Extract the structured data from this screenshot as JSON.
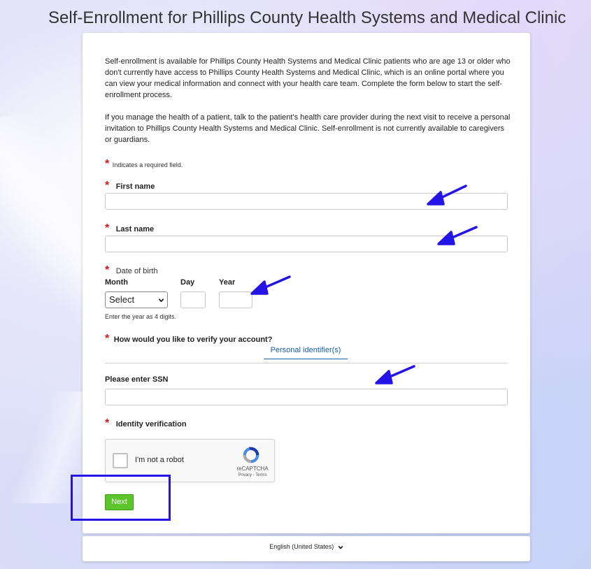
{
  "page": {
    "title": "Self-Enrollment for Phillips County Health Systems and Medical Clinic"
  },
  "intro": {
    "paragraph1": "Self-enrollment is available for Phillips County Health Systems and Medical Clinic patients who are age 13 or older who don't currently have access to Phillips County Health Systems and Medical Clinic, which is an online portal where you can view your medical information and connect with your health care team. Complete the form below to start the self-enrollment process.",
    "paragraph2": "If you manage the health of a patient, talk to the patient's health care provider during the next visit to receive a personal invitation to Phillips County Health Systems and Medical Clinic. Self-enrollment is not currently available to caregivers or guardians."
  },
  "required_marker": "*",
  "required_note": "Indicates a required field.",
  "form": {
    "first_name": {
      "label": "First name",
      "value": ""
    },
    "last_name": {
      "label": "Last name",
      "value": ""
    },
    "dob": {
      "label": "Date of birth",
      "month_label": "Month",
      "day_label": "Day",
      "year_label": "Year",
      "month_selected": "Select",
      "day_value": "",
      "year_value": "",
      "year_hint": "Enter the year as 4 digits."
    },
    "verify": {
      "label": "How would you like to verify your account?",
      "tab_label": "Personal identifier(s)"
    },
    "ssn": {
      "label": "Please enter SSN",
      "value": ""
    },
    "identity": {
      "label": "Identity verification"
    },
    "recaptcha": {
      "label": "I'm not a robot",
      "brand": "reCAPTCHA",
      "links": "Privacy - Terms"
    },
    "next_label": "Next"
  },
  "footer": {
    "language": "English (United States)"
  },
  "colors": {
    "required": "#d01818",
    "link": "#1a5fa8",
    "next_button": "#5cc52a",
    "annotation": "#2414e6"
  }
}
